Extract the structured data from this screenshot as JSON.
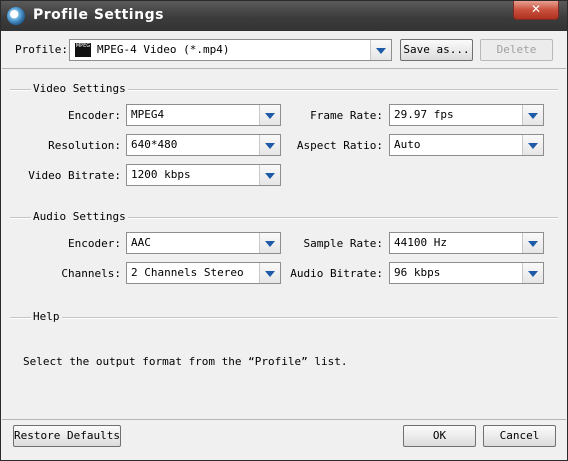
{
  "window": {
    "title": "Profile Settings",
    "close_glyph": "✕"
  },
  "profile": {
    "label": "Profile:",
    "icon_text": "MPEG",
    "value": "MPEG-4 Video (*.mp4)",
    "save_as": "Save as...",
    "delete": "Delete"
  },
  "video": {
    "title": "Video Settings",
    "encoder_label": "Encoder:",
    "encoder": "MPEG4",
    "frame_rate_label": "Frame Rate:",
    "frame_rate": "29.97 fps",
    "resolution_label": "Resolution:",
    "resolution": "640*480",
    "aspect_ratio_label": "Aspect Ratio:",
    "aspect_ratio": "Auto",
    "bitrate_label": "Video Bitrate:",
    "bitrate": "1200 kbps"
  },
  "audio": {
    "title": "Audio Settings",
    "encoder_label": "Encoder:",
    "encoder": "AAC",
    "sample_rate_label": "Sample Rate:",
    "sample_rate": "44100 Hz",
    "channels_label": "Channels:",
    "channels": "2 Channels Stereo",
    "bitrate_label": "Audio Bitrate:",
    "bitrate": "96 kbps"
  },
  "help": {
    "title": "Help",
    "text": "Select the output format from the “Profile” list."
  },
  "footer": {
    "restore": "Restore Defaults",
    "ok": "OK",
    "cancel": "Cancel"
  }
}
